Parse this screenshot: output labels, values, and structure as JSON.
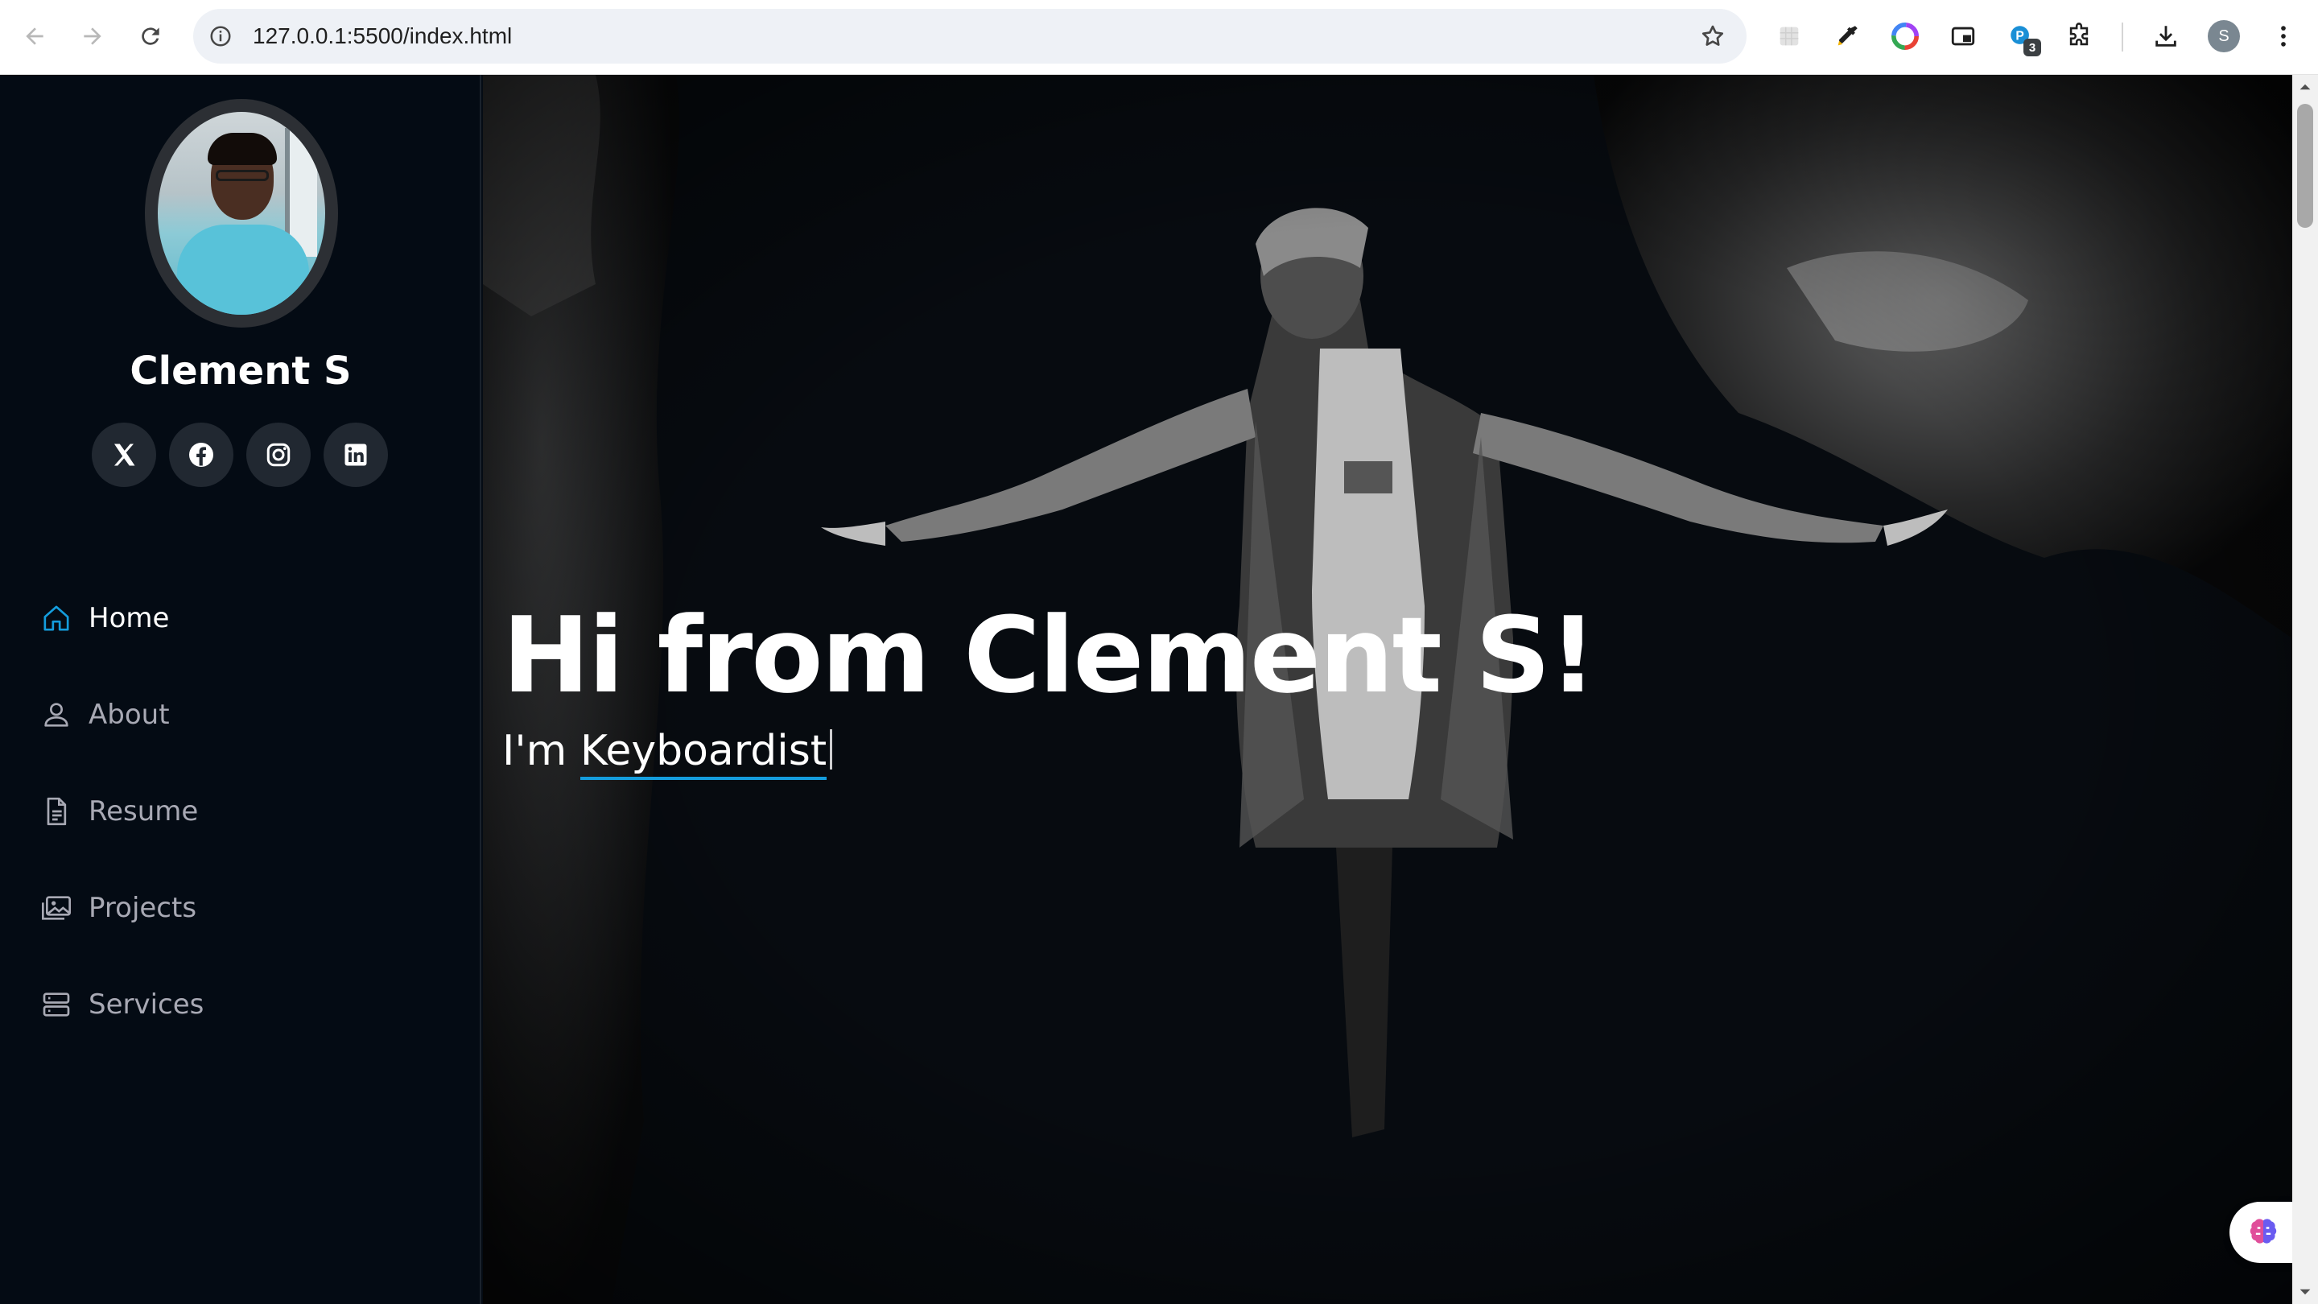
{
  "browser": {
    "url": "127.0.0.1:5500/index.html",
    "extension_badge_count": "3",
    "profile_initial": "S",
    "icons": [
      "back-icon",
      "forward-icon",
      "reload-icon",
      "site-info-icon",
      "bookmark-star-icon",
      "extension-grid-icon",
      "eyedropper-icon",
      "color-wheel-icon",
      "picture-in-picture-icon",
      "extension-badge-icon",
      "puzzle-icon",
      "download-icon",
      "profile-avatar",
      "more-vert-icon"
    ]
  },
  "sidebar": {
    "name": "Clement S",
    "socials": [
      {
        "icon": "x-twitter-icon"
      },
      {
        "icon": "facebook-icon"
      },
      {
        "icon": "instagram-icon"
      },
      {
        "icon": "linkedin-icon"
      }
    ],
    "menu": [
      {
        "label": "Home",
        "icon": "home-icon",
        "active": true
      },
      {
        "label": "About",
        "icon": "person-icon",
        "active": false
      },
      {
        "label": "Resume",
        "icon": "file-text-icon",
        "active": false
      },
      {
        "label": "Projects",
        "icon": "images-icon",
        "active": false
      },
      {
        "label": "Services",
        "icon": "server-icon",
        "active": false
      }
    ]
  },
  "hero": {
    "title": "Hi from Clement S!",
    "prefix": "I'm ",
    "typed": "Keyboardist"
  },
  "colors": {
    "accent": "#149ddd",
    "sidebar_bg": "#040b14",
    "menu_text": "#a8a9b4",
    "active_icon": "#149ddd"
  }
}
